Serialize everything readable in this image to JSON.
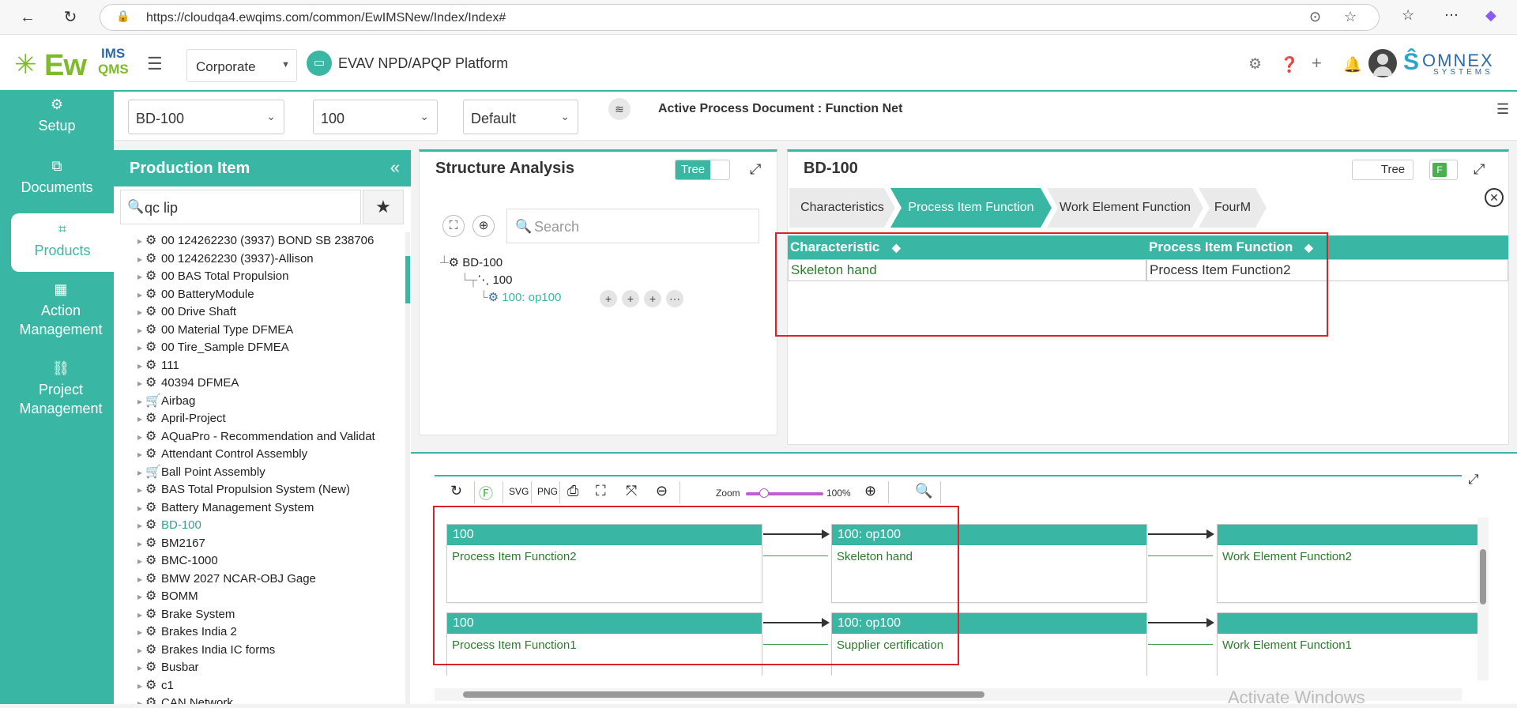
{
  "browser": {
    "url": "https://cloudqa4.ewqims.com/common/EwIMSNew/Index/Index#"
  },
  "header": {
    "logo_ew": "Ew",
    "logo_ims": "IMS",
    "logo_qms": "QMS",
    "corporate_select": "Corporate",
    "platform_title": "EVAV NPD/APQP Platform",
    "brand_main": "OMNEX",
    "brand_sub": "SYSTEMS"
  },
  "sidebar": {
    "items": [
      {
        "label": "Setup",
        "icon": "gears-icon"
      },
      {
        "label": "Documents",
        "icon": "documents-icon"
      },
      {
        "label": "Products",
        "icon": "box-icon",
        "active": true
      },
      {
        "label": "Action Management",
        "icon": "building-icon"
      },
      {
        "label": "Project Management",
        "icon": "project-tree-icon"
      }
    ]
  },
  "filters": {
    "product": "BD-100",
    "operation": "100",
    "view": "Default",
    "active_doc": "Active Process Document : Function Net"
  },
  "production_item": {
    "title": "Production Item",
    "search_value": "qc lip",
    "items": [
      {
        "label": "00 124262230 (3937) BOND SB 238706",
        "icon": "gears"
      },
      {
        "label": "00 124262230 (3937)-Allison",
        "icon": "gears"
      },
      {
        "label": "00 BAS Total Propulsion",
        "icon": "gears"
      },
      {
        "label": "00 BatteryModule",
        "icon": "gears"
      },
      {
        "label": "00 Drive Shaft",
        "icon": "gears"
      },
      {
        "label": "00 Material Type DFMEA",
        "icon": "gears"
      },
      {
        "label": "00 Tire_Sample DFMEA",
        "icon": "gears"
      },
      {
        "label": "111",
        "icon": "gears"
      },
      {
        "label": "40394 DFMEA",
        "icon": "gears"
      },
      {
        "label": "Airbag",
        "icon": "cart"
      },
      {
        "label": "April-Project",
        "icon": "gears"
      },
      {
        "label": "AQuaPro - Recommendation and Validat",
        "icon": "gears"
      },
      {
        "label": "Attendant Control Assembly",
        "icon": "gears"
      },
      {
        "label": "Ball Point Assembly",
        "icon": "cart"
      },
      {
        "label": "BAS Total Propulsion System (New)",
        "icon": "gears"
      },
      {
        "label": "Battery Management System",
        "icon": "gears"
      },
      {
        "label": "BD-100",
        "icon": "gears",
        "selected": true
      },
      {
        "label": "BM2167",
        "icon": "gears"
      },
      {
        "label": "BMC-1000",
        "icon": "gears"
      },
      {
        "label": "BMW 2027 NCAR-OBJ Gage",
        "icon": "gears"
      },
      {
        "label": "BOMM",
        "icon": "gears"
      },
      {
        "label": "Brake System",
        "icon": "gears"
      },
      {
        "label": "Brakes India 2",
        "icon": "gears"
      },
      {
        "label": "Brakes India IC forms",
        "icon": "gears"
      },
      {
        "label": "Busbar",
        "icon": "gears"
      },
      {
        "label": "c1",
        "icon": "gears"
      },
      {
        "label": "CAN Network",
        "icon": "gears"
      }
    ]
  },
  "structure_analysis": {
    "title": "Structure Analysis",
    "toggle_label": "Tree",
    "search_placeholder": "Search",
    "tree": {
      "root": "BD-100",
      "child": "100",
      "leaf": "100: op100"
    }
  },
  "pif_panel": {
    "title": "BD-100",
    "toggle_label": "Tree",
    "f_badge": "F",
    "tabs": [
      "Characteristics",
      "Process Item Function",
      "Work Element Function",
      "FourM"
    ],
    "active_tab": "Process Item Function",
    "columns": [
      "Characteristic",
      "Process Item Function"
    ],
    "rows": [
      [
        "Skeleton hand",
        "Process Item Function2"
      ]
    ]
  },
  "function_net": {
    "zoom_label": "Zoom",
    "zoom_value": "100%",
    "zoom_level": 0.2,
    "rows": [
      {
        "left": {
          "header": "100",
          "body": "Process Item Function2"
        },
        "middle": {
          "header": "100: op100",
          "body": "Skeleton hand"
        },
        "right": {
          "header": "",
          "body": "Work Element Function2"
        }
      },
      {
        "left": {
          "header": "100",
          "body": "Process Item Function1"
        },
        "middle": {
          "header": "100: op100",
          "body": "Supplier certification"
        },
        "right": {
          "header": "",
          "body": "Work Element Function1"
        }
      }
    ]
  },
  "watermark": "Activate Windows",
  "colors": {
    "accent": "#3ab6a4",
    "highlight_box": "#d9232a",
    "function_text": "#2e7a2e"
  }
}
